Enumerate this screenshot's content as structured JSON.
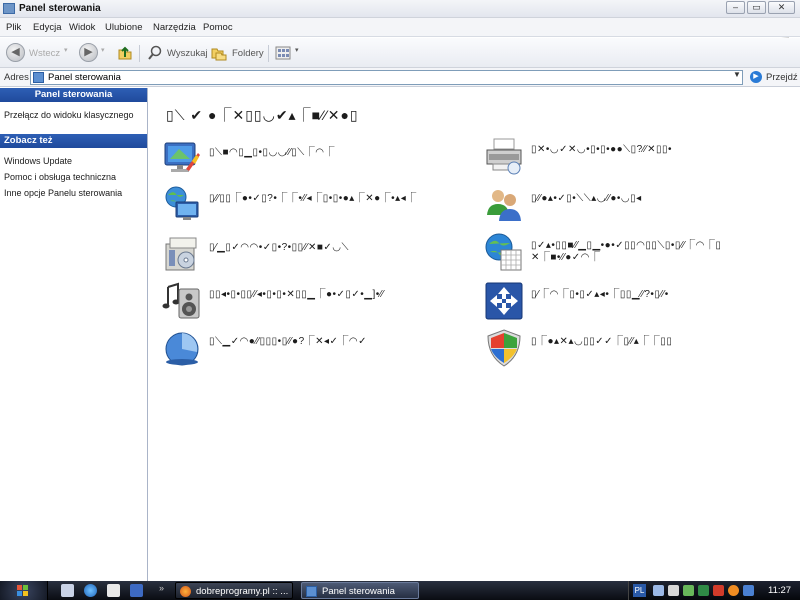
{
  "window": {
    "title": "Panel sterowania",
    "icon": "control-panel-icon"
  },
  "menu": [
    "Plik",
    "Edycja",
    "Widok",
    "Ulubione",
    "Narzędzia",
    "Pomoc"
  ],
  "toolbar": {
    "back": "Wstecz",
    "search": "Wyszukaj",
    "folders": "Foldery"
  },
  "address": {
    "label": "Adres",
    "value": "Panel sterowania",
    "go": "Przejdź"
  },
  "left_pane": {
    "header": "Panel sterowania",
    "switch_link": "Przełącz do widoku klasycznego",
    "see_also_header": "Zobacz też",
    "links": [
      "Windows Update",
      "Pomoc i obsługa techniczna",
      "Inne opcje Panelu sterowania"
    ]
  },
  "main": {
    "heading": "▯⟍ ✔ ●⎾✕▯▯◡✔▴⎾■⁄⁄✕●▯",
    "categories_left": [
      {
        "icon": "appearance-icon",
        "label": "▯⟍■◠▯▁▯•▯◡◡⁄⁄▯⟍⎾◠⎾"
      },
      {
        "icon": "network-icon",
        "label": "▯⁄⁄▯▯⎾●•✓▯?•⎾⎾•⁄⁄◂⎾▯•▯•●▴⎾✕●⎾•▴◂⎾"
      },
      {
        "icon": "add-remove-programs-icon",
        "label": "▯⁄▁▯✓◠◠•✓▯•?•▯▯⁄⁄✕■✓◡⟍"
      },
      {
        "icon": "sound-icon",
        "label": "▯▯◂•▯•▯▯⁄⁄◂•▯•▯•✕▯▯▁⎾●•✓▯✓•▁]•⁄⁄"
      },
      {
        "icon": "performance-icon",
        "label": "▯⟍▁✓◠●⁄⁄▯▯▯•▯⁄⁄●?⎾✕◂✓⎾◠✓"
      }
    ],
    "categories_right": [
      {
        "icon": "printers-icon",
        "label": "▯✕•◡✓✕◡•▯•▯•●●⟍▯?⁄⁄✕▯▯•"
      },
      {
        "icon": "user-accounts-icon",
        "label": "▯⁄⁄●▴•✓▯•⟍⟍▴◡⁄⁄●•◡▯◂"
      },
      {
        "icon": "date-time-icon",
        "label": "▯✓▴•▯▯■⁄⁄▁▯▁•●•✓▯▯◠▯▯⟍▯•▯⁄⁄⎾◠⎾▯ ✕⎾■•⁄⁄●✓◠⎾"
      },
      {
        "icon": "accessibility-icon",
        "label": "▯⁄⎾◠⎾▯•▯✓▴◂•⎾▯▯▁⁄⁄?•▯⁄⁄•"
      },
      {
        "icon": "security-center-icon",
        "label": "▯⎾●▴✕▴◡▯▯✓✓⎾▯⁄⁄▴⎾⎾▯▯"
      }
    ]
  },
  "taskbar": {
    "tasks": [
      {
        "label": "dobreprogramy.pl :: ...",
        "icon": "firefox-icon",
        "active": false
      },
      {
        "label": "Panel sterowania",
        "icon": "control-panel-icon",
        "active": true
      }
    ],
    "lang": "PL",
    "clock": "11:27",
    "overflow": "»"
  }
}
